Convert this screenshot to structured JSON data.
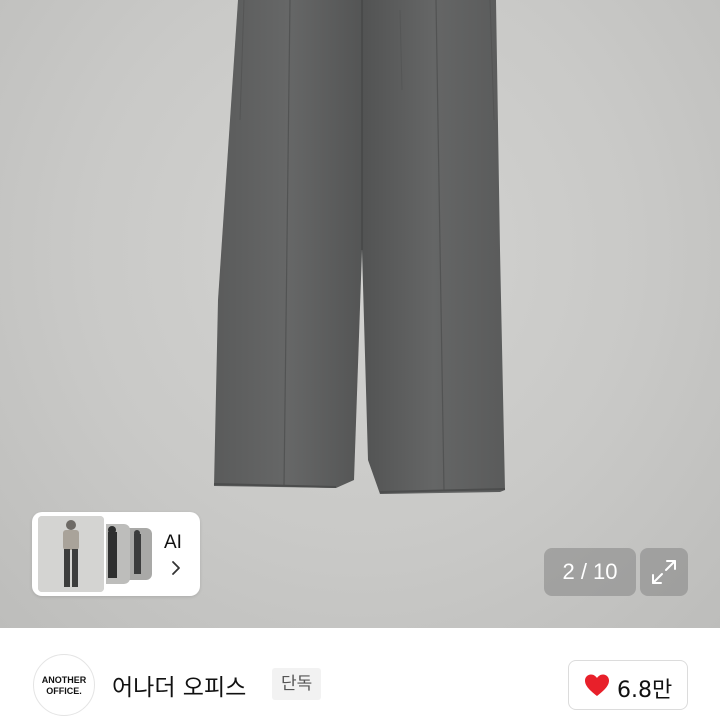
{
  "product_image": {
    "subject": "grey pleated wide trousers",
    "background_color": "#cbcbc9",
    "garment_color": "#5d5e5e"
  },
  "ai_preview": {
    "label": "AI",
    "chevron_icon": "chevron-right-icon"
  },
  "gallery": {
    "counter": "2 / 10",
    "expand_icon": "expand-icon"
  },
  "brand": {
    "logo_line1": "ANOTHER",
    "logo_line2": "OFFICE.",
    "name": "어나더 오피스",
    "badge": "단독"
  },
  "like": {
    "icon": "heart-icon",
    "icon_color": "#e8202a",
    "count": "6.8만"
  }
}
